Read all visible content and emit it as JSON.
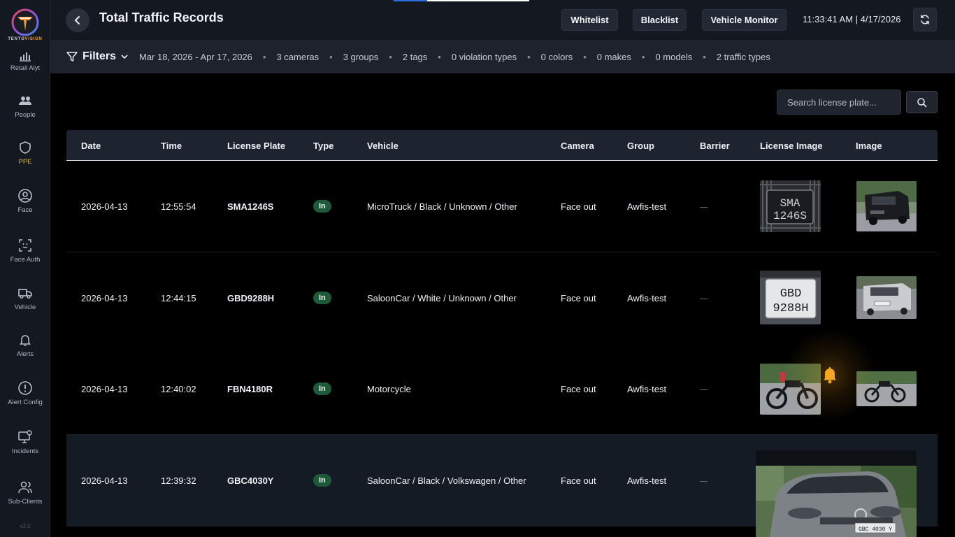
{
  "brand": {
    "name_part1": "TENTO",
    "name_part2": "VISION",
    "accent_color": "#f29a38"
  },
  "sidebar": {
    "items": [
      {
        "label": "Retail Alyt",
        "icon": "bar-chart-icon"
      },
      {
        "label": "People",
        "icon": "people-icon"
      },
      {
        "label": "PPE",
        "icon": "shield-icon"
      },
      {
        "label": "Face",
        "icon": "face-icon"
      },
      {
        "label": "Face Auth",
        "icon": "face-scan-icon"
      },
      {
        "label": "Vehicle",
        "icon": "truck-icon"
      },
      {
        "label": "Alerts",
        "icon": "bell-icon"
      },
      {
        "label": "Alert Config",
        "icon": "alert-circle-icon"
      },
      {
        "label": "Incidents",
        "icon": "monitor-gear-icon"
      },
      {
        "label": "Sub-Clients",
        "icon": "users-icon"
      }
    ],
    "active_item": "PPE",
    "version": "v2.0"
  },
  "header": {
    "title": "Total Traffic Records",
    "buttons": {
      "whitelist": "Whitelist",
      "blacklist": "Blacklist",
      "vehicle_monitor": "Vehicle Monitor"
    },
    "datetime": "11:33:41 AM | 4/17/2026"
  },
  "filters": {
    "label": "Filters",
    "date_range": "Mar 18, 2026 - Apr 17, 2026",
    "cameras": "3 cameras",
    "groups": "3 groups",
    "tags": "2 tags",
    "violation_types": "0 violation types",
    "colors": "0 colors",
    "makes": "0 makes",
    "models": "0 models",
    "traffic_types": "2 traffic types",
    "separator": "•"
  },
  "search": {
    "placeholder": "Search license plate..."
  },
  "table": {
    "columns": [
      "Date",
      "Time",
      "License Plate",
      "Type",
      "Vehicle",
      "Camera",
      "Group",
      "Barrier",
      "License Image",
      "Image"
    ],
    "rows": [
      {
        "date": "2026-04-13",
        "time": "12:55:54",
        "plate": "SMA1246S",
        "type": "In",
        "vehicle": "MicroTruck / Black / Unknown / Other",
        "camera": "Face out",
        "group": "Awfis-test",
        "barrier": "—",
        "plate_line1": "SMA",
        "plate_line2": "1246S"
      },
      {
        "date": "2026-04-13",
        "time": "12:44:15",
        "plate": "GBD9288H",
        "type": "In",
        "vehicle": "SaloonCar / White / Unknown / Other",
        "camera": "Face out",
        "group": "Awfis-test",
        "barrier": "—",
        "plate_line1": "GBD",
        "plate_line2": "9288H"
      },
      {
        "date": "2026-04-13",
        "time": "12:40:02",
        "plate": "FBN4180R",
        "type": "In",
        "vehicle": "Motorcycle",
        "camera": "Face out",
        "group": "Awfis-test",
        "barrier": "—"
      },
      {
        "date": "2026-04-13",
        "time": "12:39:32",
        "plate": "GBC4030Y",
        "type": "In",
        "vehicle": "SaloonCar / Black / Volkswagen / Other",
        "camera": "Face out",
        "group": "Awfis-test",
        "barrier": "—"
      }
    ]
  },
  "zoom_preview": {
    "plate_text": "GBC 4030 Y"
  },
  "colors": {
    "badge_in": "#1d5a3a",
    "panel": "#141821",
    "alert_bell": "#f5a623"
  }
}
